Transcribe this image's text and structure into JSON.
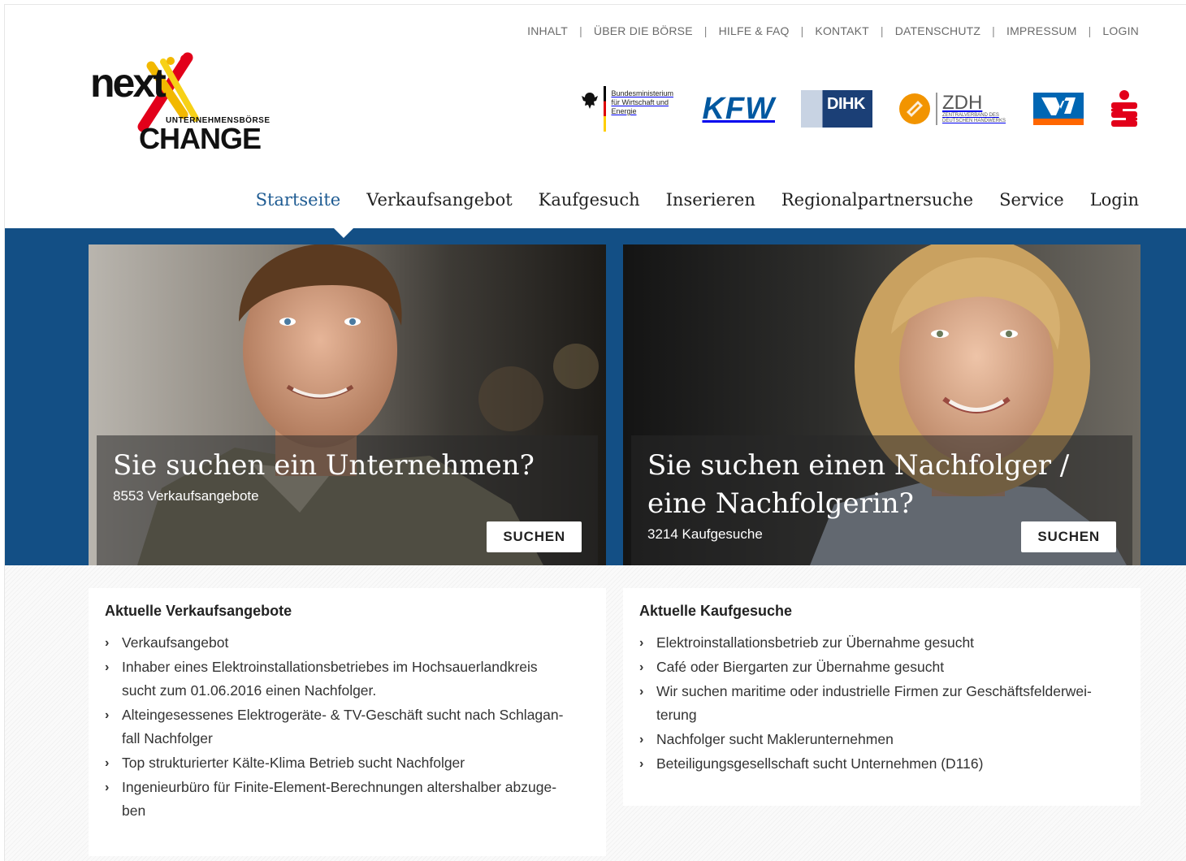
{
  "util_nav": [
    {
      "label": "INHALT"
    },
    {
      "label": "ÜBER DIE BÖRSE"
    },
    {
      "label": "HILFE & FAQ"
    },
    {
      "label": "KONTAKT"
    },
    {
      "label": "DATENSCHUTZ"
    },
    {
      "label": "IMPRESSUM"
    },
    {
      "label": "LOGIN"
    }
  ],
  "logo": {
    "word_top": "next",
    "word_sub": "UNTERNEHMENSBÖRSE",
    "word_bottom": "CHANGE"
  },
  "partners": {
    "bmwi": "Bundesministerium für Wirtschaft und Energie",
    "kfw": "KFW",
    "dihk": "DIHK",
    "zdh_big": "ZDH",
    "zdh_small": "ZENTRALVERBAND DES DEUTSCHEN HANDWERKS"
  },
  "main_nav": [
    {
      "label": "Startseite",
      "active": true
    },
    {
      "label": "Verkaufsangebot"
    },
    {
      "label": "Kaufgesuch"
    },
    {
      "label": "Inserieren"
    },
    {
      "label": "Regionalpartnersuche"
    },
    {
      "label": "Service"
    },
    {
      "label": "Login"
    }
  ],
  "hero": {
    "left": {
      "headline": "Sie suchen ein Unternehmen?",
      "count": "8553 Verkaufsangebote",
      "button": "SUCHEN"
    },
    "right": {
      "headline_line1": "Sie suchen einen Nachfolger /",
      "headline_line2": "eine Nachfolgerin?",
      "count": "3214 Kaufgesuche",
      "button": "SUCHEN"
    }
  },
  "offers": {
    "title": "Aktuelle Verkaufsangebote",
    "items": [
      {
        "lines": [
          "Verkaufsangebot"
        ]
      },
      {
        "lines": [
          "Inhaber eines Elektroinstallationsbetriebes im Hochsauerlandkreis",
          "sucht zum 01.06.2016 einen Nachfolger."
        ]
      },
      {
        "lines": [
          "Alteingesessenes Elektrogeräte- & TV-Geschäft sucht nach Schlagan-",
          "fall Nachfolger"
        ]
      },
      {
        "lines": [
          "Top strukturierter Kälte-Klima Betrieb sucht Nachfolger"
        ]
      },
      {
        "lines": [
          "Ingenieurbüro für Finite-Element-Berechnungen altershalber abzuge-",
          "ben"
        ]
      }
    ]
  },
  "requests": {
    "title": "Aktuelle Kaufgesuche",
    "items": [
      {
        "lines": [
          "Elektroinstallationsbetrieb zur Übernahme gesucht"
        ]
      },
      {
        "lines": [
          "Café oder Biergarten zur Übernahme gesucht"
        ]
      },
      {
        "lines": [
          "Wir suchen maritime oder industrielle Firmen zur Geschäftsfelderwei-",
          "terung"
        ]
      },
      {
        "lines": [
          "Nachfolger sucht Maklerunternehmen"
        ]
      },
      {
        "lines": [
          "Beteiligungsgesellschaft sucht Unternehmen (D116)"
        ]
      }
    ]
  },
  "colors": {
    "primary": "#134f85",
    "active_link": "#1e5b92",
    "kfw": "#0058a0",
    "sparkasse": "#e2001a"
  }
}
